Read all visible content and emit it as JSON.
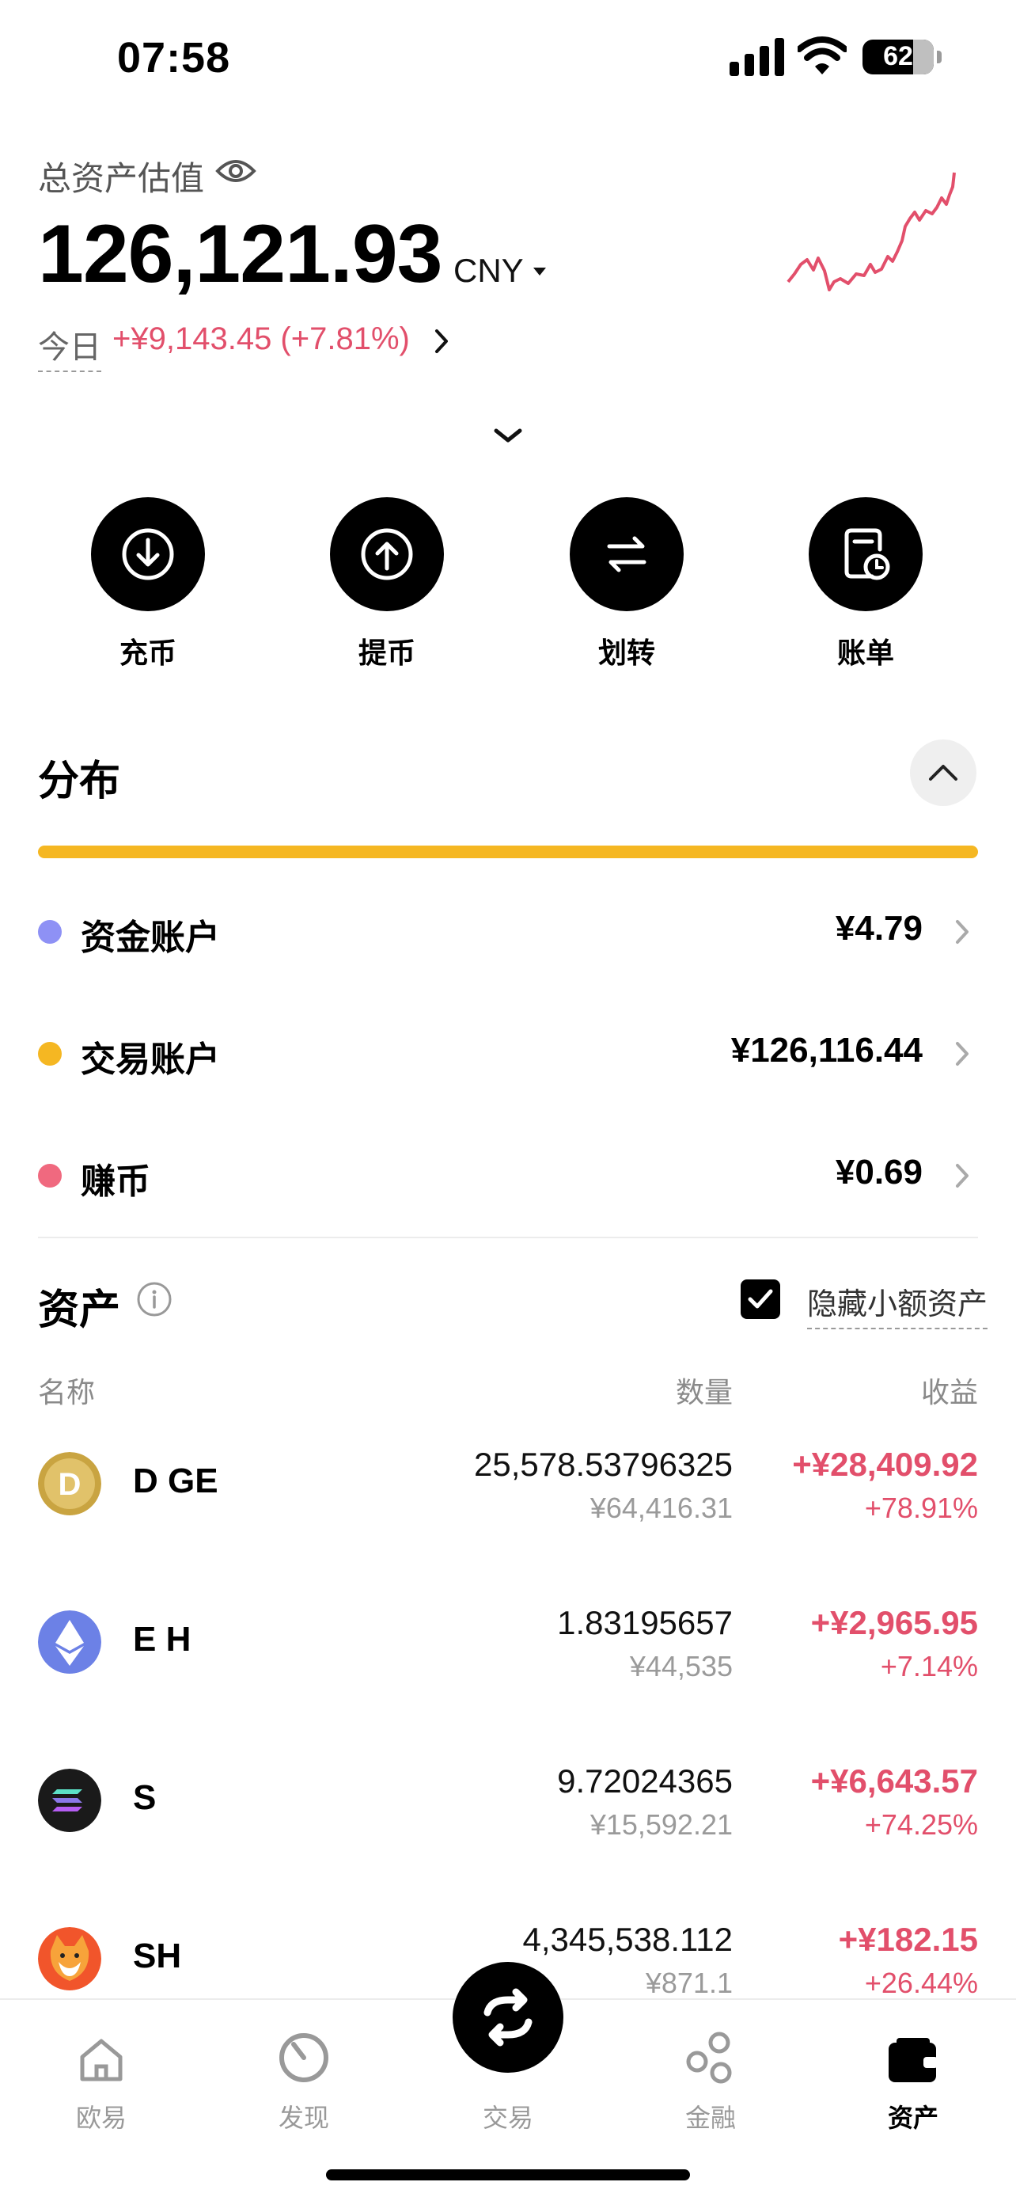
{
  "status_bar": {
    "time": "07:58",
    "battery": "62"
  },
  "summary": {
    "label": "总资产估值",
    "total": "126,121.93",
    "currency": "CNY",
    "today_label": "今日",
    "today_change": "+¥9,143.45 (+7.81%)"
  },
  "actions": [
    {
      "label": "充币",
      "icon": "deposit-icon"
    },
    {
      "label": "提币",
      "icon": "withdraw-icon"
    },
    {
      "label": "划转",
      "icon": "transfer-icon"
    },
    {
      "label": "账单",
      "icon": "bill-icon"
    }
  ],
  "distribution": {
    "title": "分布",
    "bar_color": "#F5B722",
    "rows": [
      {
        "name": "资金账户",
        "amount": "¥4.79",
        "color": "#8E91F5"
      },
      {
        "name": "交易账户",
        "amount": "¥126,116.44",
        "color": "#F5B722"
      },
      {
        "name": "赚币",
        "amount": "¥0.69",
        "color": "#F0697F"
      }
    ]
  },
  "assets": {
    "title": "资产",
    "hide_small_label": "隐藏小额资产",
    "hide_small_checked": true,
    "columns": {
      "name": "名称",
      "qty": "数量",
      "pnl": "收益"
    },
    "rows": [
      {
        "name": "D  GE",
        "qty": "25,578.53796325",
        "qty_cny": "¥64,416.31",
        "pnl": "+¥28,409.92",
        "pnl_pct": "+78.91%",
        "icon": "doge-coin-icon"
      },
      {
        "name": "E  H",
        "qty": "1.83195657",
        "qty_cny": "¥44,535",
        "pnl": "+¥2,965.95",
        "pnl_pct": "+7.14%",
        "icon": "eth-coin-icon"
      },
      {
        "name": "S  ",
        "qty": "9.72024365",
        "qty_cny": "¥15,592.21",
        "pnl": "+¥6,643.57",
        "pnl_pct": "+74.25%",
        "icon": "sol-coin-icon"
      },
      {
        "name": "SH  ",
        "qty": "4,345,538.112",
        "qty_cny": "¥871.1",
        "pnl": "+¥182.15",
        "pnl_pct": "+26.44%",
        "icon": "shib-coin-icon"
      }
    ]
  },
  "colors": {
    "positive": "#E24F6B",
    "accent": "#000000"
  },
  "nav": [
    {
      "label": "欧易",
      "icon": "home-icon"
    },
    {
      "label": "发现",
      "icon": "discover-icon"
    },
    {
      "label": "交易",
      "icon": "trade-icon"
    },
    {
      "label": "金融",
      "icon": "finance-icon"
    },
    {
      "label": "资产",
      "icon": "wallet-icon",
      "active": true
    }
  ]
}
